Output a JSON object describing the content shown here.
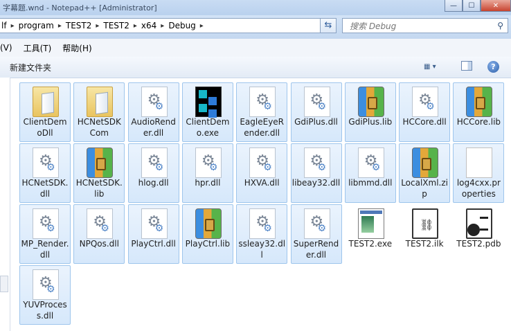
{
  "window": {
    "title": "字幕题.wnd - Notepad++ [Administrator]",
    "buttons": {
      "minimize": "—",
      "maximize": "☐",
      "close": "✕"
    }
  },
  "address": {
    "crumbs": [
      "lf",
      "program",
      "TEST2",
      "TEST2",
      "x64",
      "Debug"
    ],
    "separator": "▸",
    "dropdown": "▾",
    "refresh": "⇆"
  },
  "search": {
    "placeholder": "搜索 Debug",
    "icon": "search-icon"
  },
  "menu": {
    "items": [
      "(V)",
      "工具(T)",
      "帮助(H)"
    ]
  },
  "toolbar": {
    "new_folder": "新建文件夹",
    "view_label": "▦ ▾",
    "help": "?"
  },
  "files": [
    {
      "name": "ClientDemoDll",
      "icon": "folder",
      "selected": true
    },
    {
      "name": "HCNetSDKCom",
      "icon": "folder",
      "selected": true
    },
    {
      "name": "AudioRender.dll",
      "icon": "dll",
      "selected": true
    },
    {
      "name": "ClientDemo.exe",
      "icon": "exe",
      "selected": true
    },
    {
      "name": "EagleEyeRender.dll",
      "icon": "dll",
      "selected": true
    },
    {
      "name": "GdiPlus.dll",
      "icon": "dll",
      "selected": true
    },
    {
      "name": "GdiPlus.lib",
      "icon": "lib",
      "selected": true
    },
    {
      "name": "HCCore.dll",
      "icon": "dll",
      "selected": true
    },
    {
      "name": "HCCore.lib",
      "icon": "lib",
      "selected": true
    },
    {
      "name": "HCNetSDK.dll",
      "icon": "dll",
      "selected": true
    },
    {
      "name": "HCNetSDK.lib",
      "icon": "lib",
      "selected": true
    },
    {
      "name": "hlog.dll",
      "icon": "dll",
      "selected": true
    },
    {
      "name": "hpr.dll",
      "icon": "dll",
      "selected": true
    },
    {
      "name": "HXVA.dll",
      "icon": "dll",
      "selected": true
    },
    {
      "name": "libeay32.dll",
      "icon": "dll",
      "selected": true
    },
    {
      "name": "libmmd.dll",
      "icon": "dll",
      "selected": true
    },
    {
      "name": "LocalXml.zip",
      "icon": "lib",
      "selected": true
    },
    {
      "name": "log4cxx.properties",
      "icon": "properties",
      "selected": true
    },
    {
      "name": "MP_Render.dll",
      "icon": "dll",
      "selected": true
    },
    {
      "name": "NPQos.dll",
      "icon": "dll",
      "selected": true
    },
    {
      "name": "PlayCtrl.dll",
      "icon": "dll",
      "selected": true
    },
    {
      "name": "PlayCtrl.lib",
      "icon": "lib",
      "selected": true
    },
    {
      "name": "ssleay32.dll",
      "icon": "dll",
      "selected": true
    },
    {
      "name": "SuperRender.dll",
      "icon": "dll",
      "selected": true
    },
    {
      "name": "TEST2.exe",
      "icon": "window-exe",
      "selected": false
    },
    {
      "name": "TEST2.ilk",
      "icon": "ilk",
      "selected": false
    },
    {
      "name": "TEST2.pdb",
      "icon": "pdb",
      "selected": false
    },
    {
      "name": "YUVProcess.dll",
      "icon": "dll",
      "selected": true
    }
  ]
}
